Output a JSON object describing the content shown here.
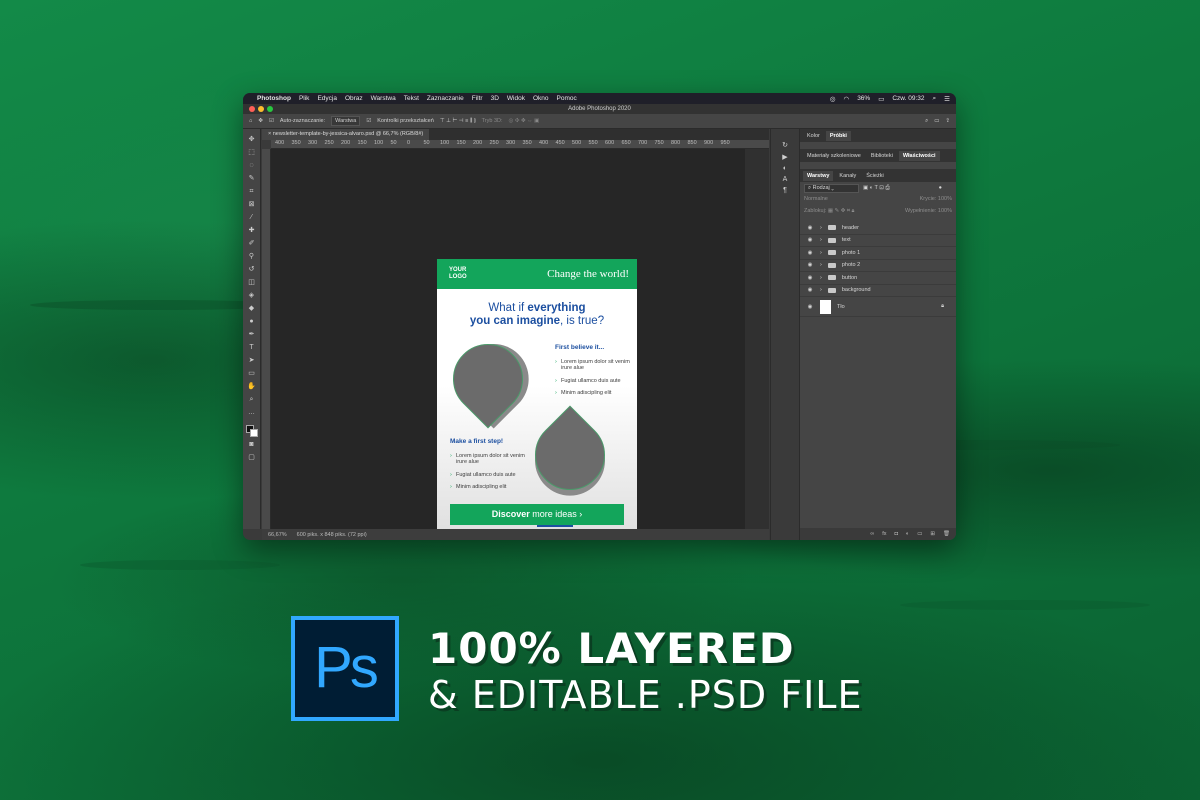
{
  "mac_menu": {
    "app_name": "Photoshop",
    "items": [
      "Plik",
      "Edycja",
      "Obraz",
      "Warstwa",
      "Tekst",
      "Zaznaczanie",
      "Filtr",
      "3D",
      "Widok",
      "Okno",
      "Pomoc"
    ],
    "battery": "36%",
    "clock": "Czw. 09:32"
  },
  "window": {
    "title": "Adobe Photoshop 2020"
  },
  "options_bar": {
    "auto_select_label": "Auto-zaznaczanie:",
    "auto_select_value": "Warstwa",
    "transform_controls_label": "Kontrolki przekształceń",
    "mode_3d_label": "Tryb 3D:"
  },
  "document": {
    "tab_title": "newsletter-template-by-jessica-alvaro.psd @ 66,7% (RGB/8#)",
    "ruler_ticks": [
      "400",
      "350",
      "300",
      "250",
      "200",
      "150",
      "100",
      "50",
      "0",
      "50",
      "100",
      "150",
      "200",
      "250",
      "300",
      "350",
      "400",
      "450",
      "500",
      "550",
      "600",
      "650",
      "700",
      "750",
      "800",
      "850",
      "900",
      "950"
    ],
    "zoom": "66,67%",
    "size_info": "600 piks. x 848 piks. (72 ppi)"
  },
  "newsletter": {
    "logo": "YOUR\nLOGO",
    "slogan": "Change the world!",
    "headline_part1": "What if ",
    "headline_bold": "everything",
    "headline_line2_bold": "you can imagine",
    "headline_line2_rest": ", is true?",
    "block1": {
      "heading": "First believe it...",
      "items": [
        "Lorem ipsum dolor sit venim irure alue",
        "Fugiat ullamco duis aute",
        "Minim adiscipling elit"
      ]
    },
    "block2": {
      "heading": "Make a first step!",
      "items": [
        "Lorem ipsum dolor sit venim irure alue",
        "Fugiat ullamco duis aute",
        "Minim adiscipling elit"
      ]
    },
    "button_bold": "Discover",
    "button_rest": " more ideas  ›"
  },
  "panels": {
    "top_tabs": [
      "Kolor",
      "Próbki"
    ],
    "mid_tabs": [
      "Materiały szkoleniowe",
      "Biblioteki",
      "Właściwości"
    ],
    "layer_tabs": [
      "Warstwy",
      "Kanały",
      "Ścieżki"
    ],
    "filter_label": "Rodzaj",
    "blend_mode": "Normalne",
    "opacity_label": "Krycie:",
    "opacity_value": "100%",
    "lock_label": "Zablokuj:",
    "fill_label": "Wypełnienie:",
    "fill_value": "100%",
    "layers": [
      "header",
      "text",
      "photo 1",
      "photo 2",
      "button",
      "background"
    ],
    "background_layer": "Tło"
  },
  "banner": {
    "ps_logo_text": "Ps",
    "line1": "100% LAYERED",
    "line2": "& EDITABLE .PSD FILE"
  },
  "colors": {
    "background_green": "#0f6b38",
    "brand_green": "#13a55b",
    "brand_blue": "#1c4fa0",
    "ps_blue": "#31a8ff",
    "ps_dark": "#001d34"
  }
}
